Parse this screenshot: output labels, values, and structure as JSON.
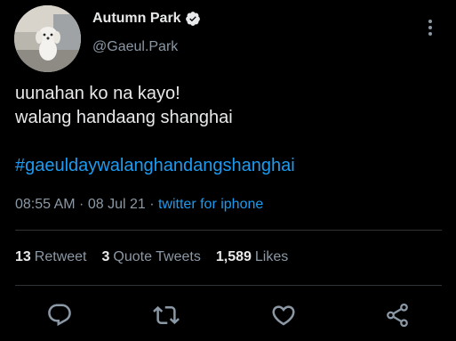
{
  "user": {
    "name": "Autumn Park",
    "handle": "@Gaeul.Park"
  },
  "tweet": {
    "line1": "uunahan ko na kayo!",
    "line2": "walang handaang shanghai",
    "hashtag": "#gaeuldaywalanghandangshanghai"
  },
  "meta": {
    "time": "08:55 AM",
    "sep1": " · ",
    "date": "08 Jul 21",
    "sep2": " · ",
    "source": "twitter for iphone"
  },
  "stats": [
    {
      "count": "13",
      "label": "Retweet"
    },
    {
      "count": "3",
      "label": "Quote Tweets"
    },
    {
      "count": "1,589",
      "label": "Likes"
    }
  ],
  "colors": {
    "background": "#000000",
    "text": "#e7e9ea",
    "secondary": "#8b98a5",
    "accent": "#1d9bf0",
    "divider": "#2f3336"
  },
  "icons": {
    "verified": "verified-badge-icon",
    "more": "more-vertical-icon",
    "reply": "reply-icon",
    "retweet": "retweet-icon",
    "like": "heart-icon",
    "share": "share-icon"
  }
}
